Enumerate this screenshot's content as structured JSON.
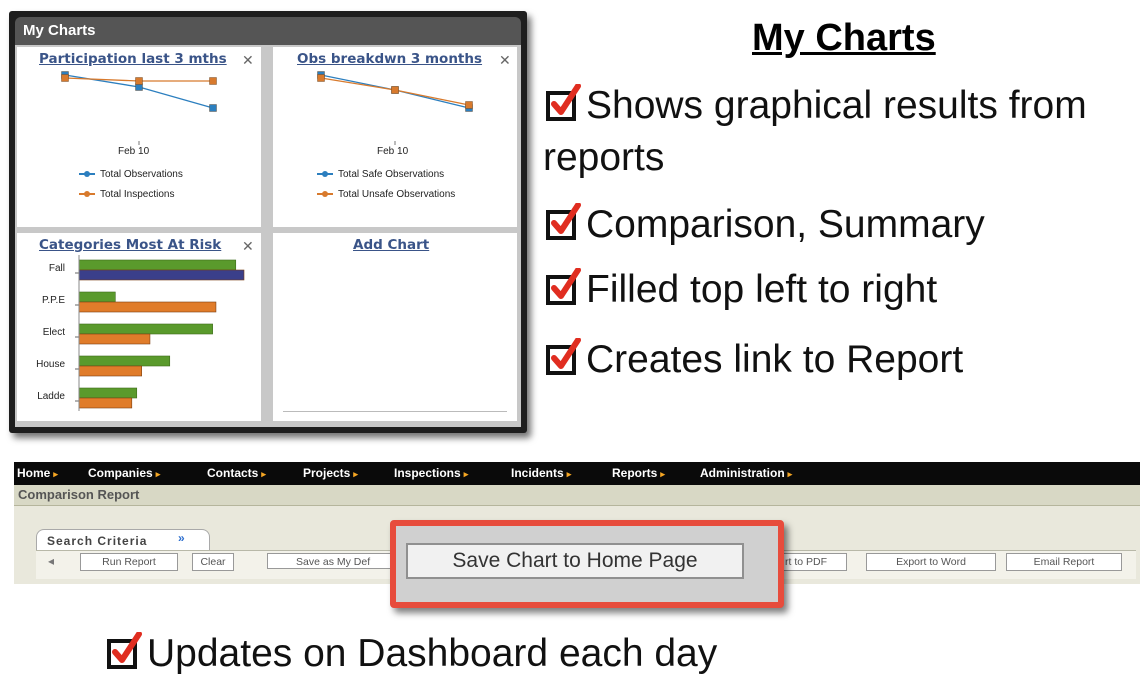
{
  "panel": {
    "title": "My Charts"
  },
  "widgets": {
    "participation": {
      "title": "Participation last 3 mths",
      "x_label": "Feb 10",
      "legend": [
        "Total Observations",
        "Total Inspections"
      ],
      "colors": {
        "series1": "#2c7fbf",
        "series2": "#d87a2d"
      }
    },
    "obs_breakdown": {
      "title": "Obs breakdwn 3 months",
      "x_label": "Feb 10",
      "legend": [
        "Total Safe Observations",
        "Total Unsafe Observations"
      ]
    },
    "categories": {
      "title": "Categories Most At Risk",
      "labels": [
        "Fall",
        "P.P.E",
        "Elect",
        "House",
        "Ladde"
      ],
      "colors": {
        "green": "#5a9a2c",
        "orange": "#e07c2a",
        "navy": "#3a3f8a"
      }
    },
    "add_chart": {
      "label": "Add Chart"
    }
  },
  "chart_data": [
    {
      "type": "line",
      "title": "Participation last 3 mths",
      "x_tick": "Feb 10",
      "series": [
        {
          "name": "Total Observations",
          "values": [
            100,
            96,
            89
          ]
        },
        {
          "name": "Total Inspections",
          "values": [
            99,
            98,
            98
          ]
        }
      ]
    },
    {
      "type": "line",
      "title": "Obs breakdwn 3 months",
      "x_tick": "Feb 10",
      "series": [
        {
          "name": "Total Safe Observations",
          "values": [
            100,
            95,
            89
          ]
        },
        {
          "name": "Total Unsafe Observations",
          "values": [
            99,
            95,
            90
          ]
        }
      ]
    },
    {
      "type": "bar",
      "title": "Categories Most At Risk",
      "categories": [
        "Fall",
        "P.P.E",
        "Elect",
        "House",
        "Ladde"
      ],
      "series": [
        {
          "values": [
            95,
            22,
            81,
            55,
            35
          ]
        },
        {
          "values": [
            100,
            83,
            43,
            38,
            32
          ]
        }
      ]
    }
  ],
  "heading": "My Charts",
  "bullets": [
    "Shows graphical results from",
    "reports",
    "Comparison, Summary",
    "Filled top left to right",
    "Creates link to Report"
  ],
  "bottom_bullet": "Updates on Dashboard each day",
  "check_colors": {
    "box": "#111111",
    "tick": "#e02d20"
  },
  "app": {
    "nav": [
      "Home",
      "Companies",
      "Contacts",
      "Projects",
      "Inspections",
      "Incidents",
      "Reports",
      "Administration"
    ],
    "page_title": "Comparison Report",
    "search_criteria": "Search Criteria",
    "buttons": [
      "Run Report",
      "Clear",
      "Save as My Def",
      "rt to PDF",
      "Export to Word",
      "Email Report"
    ],
    "callout_button": "Save Chart to Home Page"
  }
}
